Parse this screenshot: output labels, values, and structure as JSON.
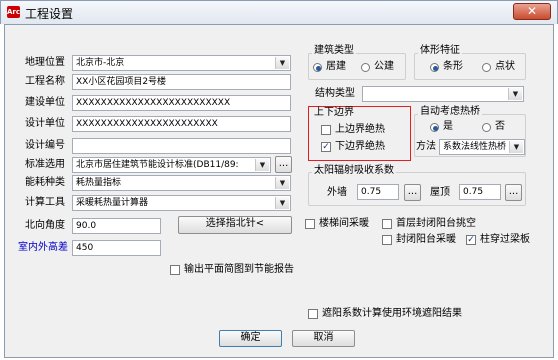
{
  "window": {
    "title": "工程设置",
    "app_icon_text": "Arc",
    "close_symbol": "✕"
  },
  "left": {
    "location": {
      "label": "地理位置",
      "value": "北京市-北京"
    },
    "project_name": {
      "label": "工程名称",
      "value": "XX小区花园项目2号楼"
    },
    "build_unit": {
      "label": "建设单位",
      "value": "XXXXXXXXXXXXXXXXXXXXXXXXX"
    },
    "design_unit": {
      "label": "设计单位",
      "value": "XXXXXXXXXXXXXXXXXXXXXXX"
    },
    "design_no": {
      "label": "设计编号",
      "value": ""
    },
    "standard": {
      "label": "标准选用",
      "value": "北京市居住建筑节能设计标准(DB11/89:",
      "browse": "..."
    },
    "energy_type": {
      "label": "能耗种类",
      "value": "耗热量指标"
    },
    "calc_tool": {
      "label": "计算工具",
      "value": "采暖耗热量计算器"
    },
    "north_angle": {
      "label": "北向角度",
      "value": "90.0",
      "button": "选择指北针<"
    },
    "height_diff": {
      "label": "室内外高差",
      "value": "450"
    },
    "export_report": {
      "label": "输出平面简图到节能报告",
      "checked": false
    }
  },
  "right": {
    "building_type": {
      "title": "建筑类型",
      "options": [
        "居建",
        "公建"
      ],
      "selected": "居建"
    },
    "body_feature": {
      "title": "体形特征",
      "options": [
        "条形",
        "点状"
      ],
      "selected": "条形"
    },
    "structure_type": {
      "label": "结构类型",
      "value": ""
    },
    "boundary": {
      "title": "上下边界",
      "upper": {
        "label": "上边界绝热",
        "checked": false
      },
      "lower": {
        "label": "下边界绝热",
        "checked": true
      }
    },
    "thermal_bridge": {
      "title": "自动考虑热桥",
      "options": [
        "是",
        "否"
      ],
      "selected": "是",
      "method_label": "方法",
      "method_value": "系数法线性热桥"
    },
    "solar": {
      "title": "太阳辐射吸收系数",
      "wall_label": "外墙",
      "wall_value": "0.75",
      "roof_label": "屋顶",
      "roof_value": "0.75",
      "browse": "..."
    },
    "checks": {
      "stairwell_heating": {
        "label": "楼梯间采暖",
        "checked": false
      },
      "first_floor_balcony": {
        "label": "首层封闭阳台挑空",
        "checked": false
      },
      "closed_balcony_heating": {
        "label": "封闭阳台采暖",
        "checked": false
      },
      "column_beam": {
        "label": "柱穿过梁板",
        "checked": true
      }
    },
    "shading_env": {
      "label": "遮阳系数计算使用环境遮阳结果",
      "checked": false
    }
  },
  "footer": {
    "ok": "确定",
    "cancel": "取消"
  },
  "icons": {
    "combo_arrow": "▼",
    "check_mark": "✓"
  },
  "colors": {
    "blue_label": "#0000c8",
    "highlight_border": "#e02020"
  }
}
